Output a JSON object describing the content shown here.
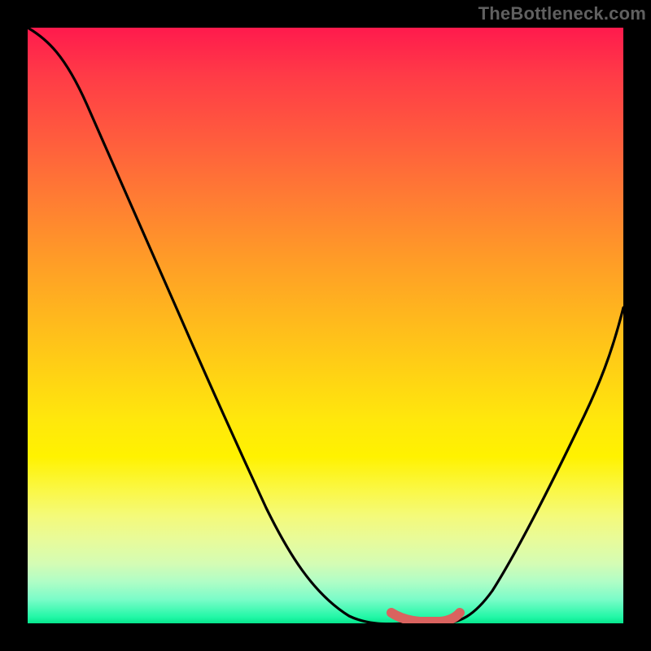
{
  "watermark": "TheBottleneck.com",
  "chart_data": {
    "type": "line",
    "title": "",
    "xlabel": "",
    "ylabel": "",
    "xlim": [
      0,
      1
    ],
    "ylim": [
      0,
      1
    ],
    "series": [
      {
        "name": "bottleneck-curve",
        "x": [
          0.0,
          0.05,
          0.1,
          0.15,
          0.2,
          0.25,
          0.3,
          0.35,
          0.4,
          0.45,
          0.5,
          0.55,
          0.58,
          0.61,
          0.64,
          0.67,
          0.7,
          0.73,
          0.78,
          0.83,
          0.88,
          0.93,
          0.97,
          1.0
        ],
        "y": [
          1.0,
          0.98,
          0.935,
          0.87,
          0.795,
          0.715,
          0.63,
          0.54,
          0.45,
          0.355,
          0.255,
          0.15,
          0.085,
          0.035,
          0.005,
          0.0,
          0.0,
          0.008,
          0.055,
          0.145,
          0.255,
          0.37,
          0.465,
          0.53
        ]
      },
      {
        "name": "sweet-spot-band",
        "x": [
          0.61,
          0.62,
          0.63,
          0.64,
          0.65,
          0.66,
          0.67,
          0.68,
          0.69,
          0.7,
          0.71,
          0.72,
          0.725
        ],
        "y": [
          0.018,
          0.01,
          0.006,
          0.004,
          0.003,
          0.003,
          0.004,
          0.005,
          0.007,
          0.01,
          0.014,
          0.018,
          0.02
        ]
      }
    ],
    "background_gradient": {
      "top": "#ff1a4d",
      "mid": "#fff200",
      "bottom": "#06e58c"
    },
    "sweet_spot_color": "#d9635f"
  }
}
